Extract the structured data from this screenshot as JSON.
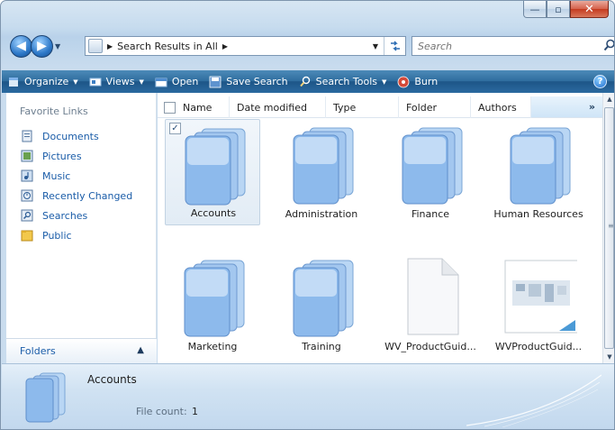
{
  "window": {
    "caption_buttons": [
      {
        "name": "minimize-button",
        "glyph": "▬"
      },
      {
        "name": "maximize-button",
        "glyph": "☐"
      },
      {
        "name": "close-button",
        "glyph": "✕"
      }
    ]
  },
  "address": {
    "path_label": "Search Results in All",
    "search_placeholder": "Search"
  },
  "toolbar": {
    "organize": "Organize",
    "views": "Views",
    "open": "Open",
    "save_search": "Save Search",
    "search_tools": "Search Tools",
    "burn": "Burn",
    "help": "?"
  },
  "nav": {
    "heading": "Favorite Links",
    "items": [
      {
        "label": "Documents",
        "icon": "documents-icon"
      },
      {
        "label": "Pictures",
        "icon": "pictures-icon"
      },
      {
        "label": "Music",
        "icon": "music-icon"
      },
      {
        "label": "Recently Changed",
        "icon": "recently-changed-icon"
      },
      {
        "label": "Searches",
        "icon": "searches-icon"
      },
      {
        "label": "Public",
        "icon": "public-folder-icon"
      }
    ],
    "folders_label": "Folders"
  },
  "columns": {
    "name": "Name",
    "date_modified": "Date modified",
    "type": "Type",
    "folder": "Folder",
    "authors": "Authors",
    "more": "»"
  },
  "items": [
    {
      "label": "Accounts",
      "kind": "folder",
      "selected": true
    },
    {
      "label": "Administration",
      "kind": "folder"
    },
    {
      "label": "Finance",
      "kind": "folder"
    },
    {
      "label": "Human Resources",
      "kind": "folder"
    },
    {
      "label": "Marketing",
      "kind": "folder"
    },
    {
      "label": "Training",
      "kind": "folder"
    },
    {
      "label": "WV_ProductGuid...",
      "kind": "document"
    },
    {
      "label": "WVProductGuid...",
      "kind": "image"
    }
  ],
  "details": {
    "name": "Accounts",
    "count_label": "File count:",
    "count_value": "1"
  },
  "colors": {
    "command_bar": "#2f6d9f",
    "link_blue": "#1a5ca8",
    "folder_blue": "#7fb2ea"
  }
}
